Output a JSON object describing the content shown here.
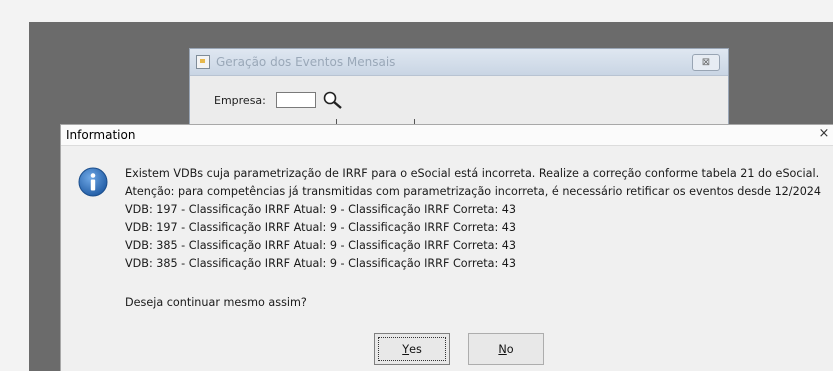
{
  "background_window": {
    "title": "Geração dos Eventos Mensais",
    "close_glyph": "⊠",
    "empresa_label": "Empresa:",
    "empresa_value": ""
  },
  "dialog": {
    "title": "Information",
    "close_glyph": "×",
    "message_lines": [
      "Existem VDBs cuja parametrização de IRRF para o eSocial está incorreta. Realize a correção conforme tabela 21 do eSocial.",
      "Atenção: para competências já transmitidas com parametrização incorreta, é necessário retificar os eventos desde 12/2024",
      "VDB: 197 - Classificação IRRF Atual: 9 - Classificação IRRF Correta: 43",
      "VDB: 197 - Classificação IRRF Atual: 9 - Classificação IRRF Correta: 43",
      "VDB: 385 - Classificação IRRF Atual: 9 - Classificação IRRF Correta: 43",
      "VDB: 385 - Classificação IRRF Atual: 9 - Classificação IRRF Correta: 43"
    ],
    "question": "Deseja continuar mesmo assim?",
    "yes_label_mnemonic": "Y",
    "yes_label_rest": "es",
    "no_label_mnemonic": "N",
    "no_label_rest": "o"
  },
  "colors": {
    "desktop": "#6b6b6b",
    "dialog_bg": "#f0f0f0",
    "info_icon": "#2f6fb6"
  },
  "icons": [
    "app-icon",
    "search-icon",
    "info-icon",
    "close-icon"
  ]
}
